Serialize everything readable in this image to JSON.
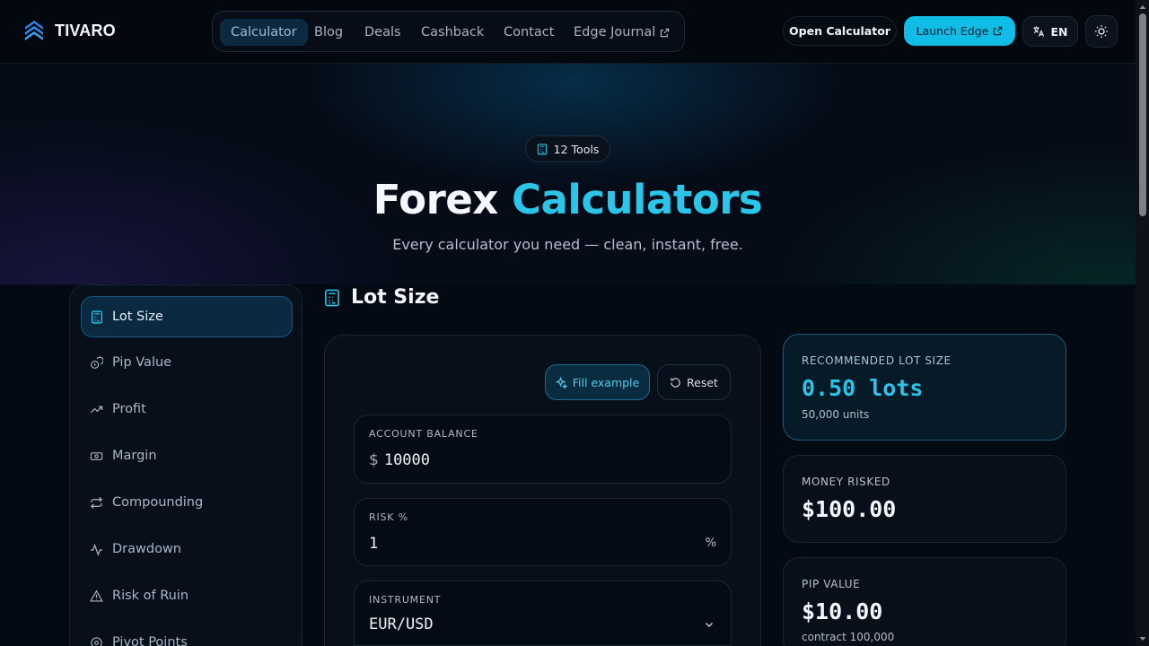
{
  "brand": {
    "name": "TIVARO",
    "accent": "#2ac5e8",
    "launch_color": "#10bde6"
  },
  "nav": {
    "items": [
      {
        "label": "Calculator",
        "active": true
      },
      {
        "label": "Blog"
      },
      {
        "label": "Deals"
      },
      {
        "label": "Cashback"
      },
      {
        "label": "Contact"
      },
      {
        "label": "Edge Journal",
        "icon": "external-link-icon"
      }
    ]
  },
  "header_actions": {
    "open_calculator": "Open Calculator",
    "launch_edge": "Launch Edge",
    "language": "EN",
    "theme_icon": "sun-icon"
  },
  "hero": {
    "badge": "12 Tools",
    "title_main": "Forex",
    "title_accent": "Calculators",
    "subtitle": "Every calculator you need — clean, instant, free."
  },
  "sidebar": {
    "items": [
      {
        "label": "Lot Size",
        "icon": "calculator-icon",
        "active": true
      },
      {
        "label": "Pip Value",
        "icon": "coins-icon"
      },
      {
        "label": "Profit",
        "icon": "trending-up-icon"
      },
      {
        "label": "Margin",
        "icon": "banknote-icon"
      },
      {
        "label": "Compounding",
        "icon": "repeat-icon"
      },
      {
        "label": "Drawdown",
        "icon": "activity-icon"
      },
      {
        "label": "Risk of Ruin",
        "icon": "warning-icon"
      },
      {
        "label": "Pivot Points",
        "icon": "pivot-icon"
      }
    ]
  },
  "calculator": {
    "title": "Lot Size",
    "fill_example": "Fill example",
    "reset": "Reset",
    "fields": {
      "account_balance": {
        "label": "ACCOUNT BALANCE",
        "prefix": "$",
        "value": "10000"
      },
      "risk": {
        "label": "RISK %",
        "value": "1",
        "suffix": "%"
      },
      "instrument": {
        "label": "INSTRUMENT",
        "value": "EUR/USD"
      }
    }
  },
  "results": {
    "lot_size": {
      "label": "RECOMMENDED LOT SIZE",
      "value": "0.50 lots",
      "sub": "50,000 units"
    },
    "money_risked": {
      "label": "MONEY RISKED",
      "value": "$100.00"
    },
    "pip_value": {
      "label": "PIP VALUE",
      "value": "$10.00",
      "sub": "contract 100,000"
    }
  }
}
